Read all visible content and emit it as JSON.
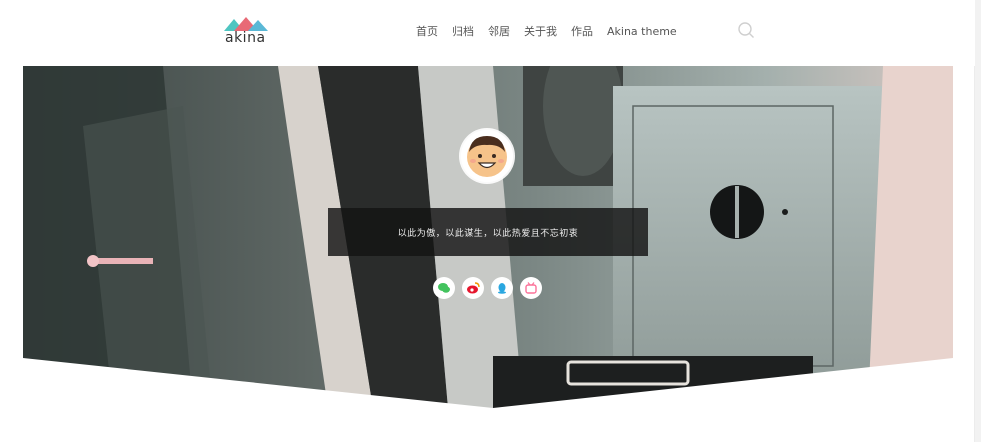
{
  "header": {
    "logo_text": "akina",
    "nav": [
      {
        "label": "首页"
      },
      {
        "label": "归档"
      },
      {
        "label": "邻居"
      },
      {
        "label": "关于我"
      },
      {
        "label": "作品"
      },
      {
        "label": "Akina theme"
      }
    ]
  },
  "hero": {
    "motto": "以此为傲，以此谋生，以此热爱且不忘初衷"
  },
  "colors": {
    "logo_left": "#4ec5c1",
    "logo_right": "#e86a76",
    "wechat": "#43c35e",
    "weibo": "#e6162d",
    "qq": "#2aa7e0",
    "bilibili": "#fb7299"
  },
  "icons": [
    "search-icon",
    "wechat-icon",
    "weibo-icon",
    "qq-icon",
    "bilibili-icon"
  ]
}
